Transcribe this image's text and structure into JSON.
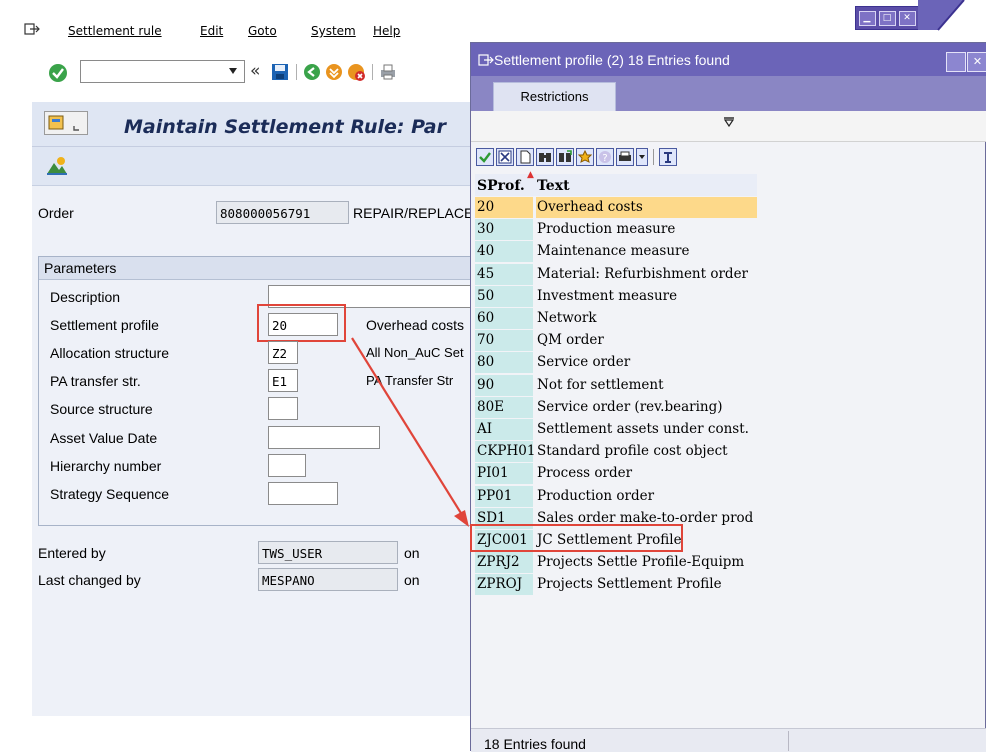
{
  "menu": {
    "items": [
      "Settlement rule",
      "Edit",
      "Goto",
      "System",
      "Help"
    ]
  },
  "toolbar": {
    "command_value": "",
    "back_symbol": "«"
  },
  "page": {
    "title": "Maintain Settlement Rule: Par"
  },
  "order": {
    "label": "Order",
    "number": "808000056791",
    "description": "REPAIR/REPLACE"
  },
  "parameters": {
    "header": "Parameters",
    "description_label": "Description",
    "description_value": "",
    "settlement_profile_label": "Settlement profile",
    "settlement_profile_value": "20",
    "settlement_profile_text": "Overhead costs",
    "allocation_structure_label": "Allocation structure",
    "allocation_structure_value": "Z2",
    "allocation_structure_text": "All Non_AuC Set",
    "pa_transfer_label": "PA transfer str.",
    "pa_transfer_value": "E1",
    "pa_transfer_text": "PA Transfer Str",
    "source_structure_label": "Source structure",
    "source_structure_value": "",
    "asset_value_date_label": "Asset Value Date",
    "asset_value_date_value": "",
    "hierarchy_number_label": "Hierarchy number",
    "hierarchy_number_value": "",
    "strategy_sequence_label": "Strategy Sequence",
    "strategy_sequence_value": ""
  },
  "admin": {
    "entered_by_label": "Entered by",
    "entered_by_value": "TWS_USER",
    "entered_on_label": "on",
    "last_changed_label": "Last changed by",
    "last_changed_value": "MESPANO",
    "last_changed_on_label": "on"
  },
  "popup": {
    "title": "Settlement profile (2)   18 Entries found",
    "tab": "Restrictions",
    "columns": [
      "SProf.",
      "Text"
    ],
    "selected_index": 0,
    "highlighted_index": 15,
    "rows": [
      {
        "sprof": "20",
        "text": "Overhead costs"
      },
      {
        "sprof": "30",
        "text": "Production measure"
      },
      {
        "sprof": "40",
        "text": "Maintenance measure"
      },
      {
        "sprof": "45",
        "text": "Material: Refurbishment order"
      },
      {
        "sprof": "50",
        "text": "Investment measure"
      },
      {
        "sprof": "60",
        "text": "Network"
      },
      {
        "sprof": "70",
        "text": "QM order"
      },
      {
        "sprof": "80",
        "text": "Service order"
      },
      {
        "sprof": "90",
        "text": "Not for settlement"
      },
      {
        "sprof": "80E",
        "text": "Service order (rev.bearing)"
      },
      {
        "sprof": "AI",
        "text": "Settlement assets under const."
      },
      {
        "sprof": "CKPH01",
        "text": "Standard profile cost object"
      },
      {
        "sprof": "PI01",
        "text": "Process order"
      },
      {
        "sprof": "PP01",
        "text": "Production order"
      },
      {
        "sprof": "SD1",
        "text": "Sales order make-to-order prod"
      },
      {
        "sprof": "ZJC001",
        "text": "JC Settlement Profile"
      },
      {
        "sprof": "ZPRJ2",
        "text": "Projects Settle Profile-Equipm"
      },
      {
        "sprof": "ZPROJ",
        "text": "Projects Settlement Profile"
      }
    ],
    "status": "18 Entries found"
  },
  "colors": {
    "highlight": "#e0453a",
    "selected_row": "#fdd98a",
    "key_column": "#cbeaea",
    "popup_title_bg": "#6b64b8"
  }
}
